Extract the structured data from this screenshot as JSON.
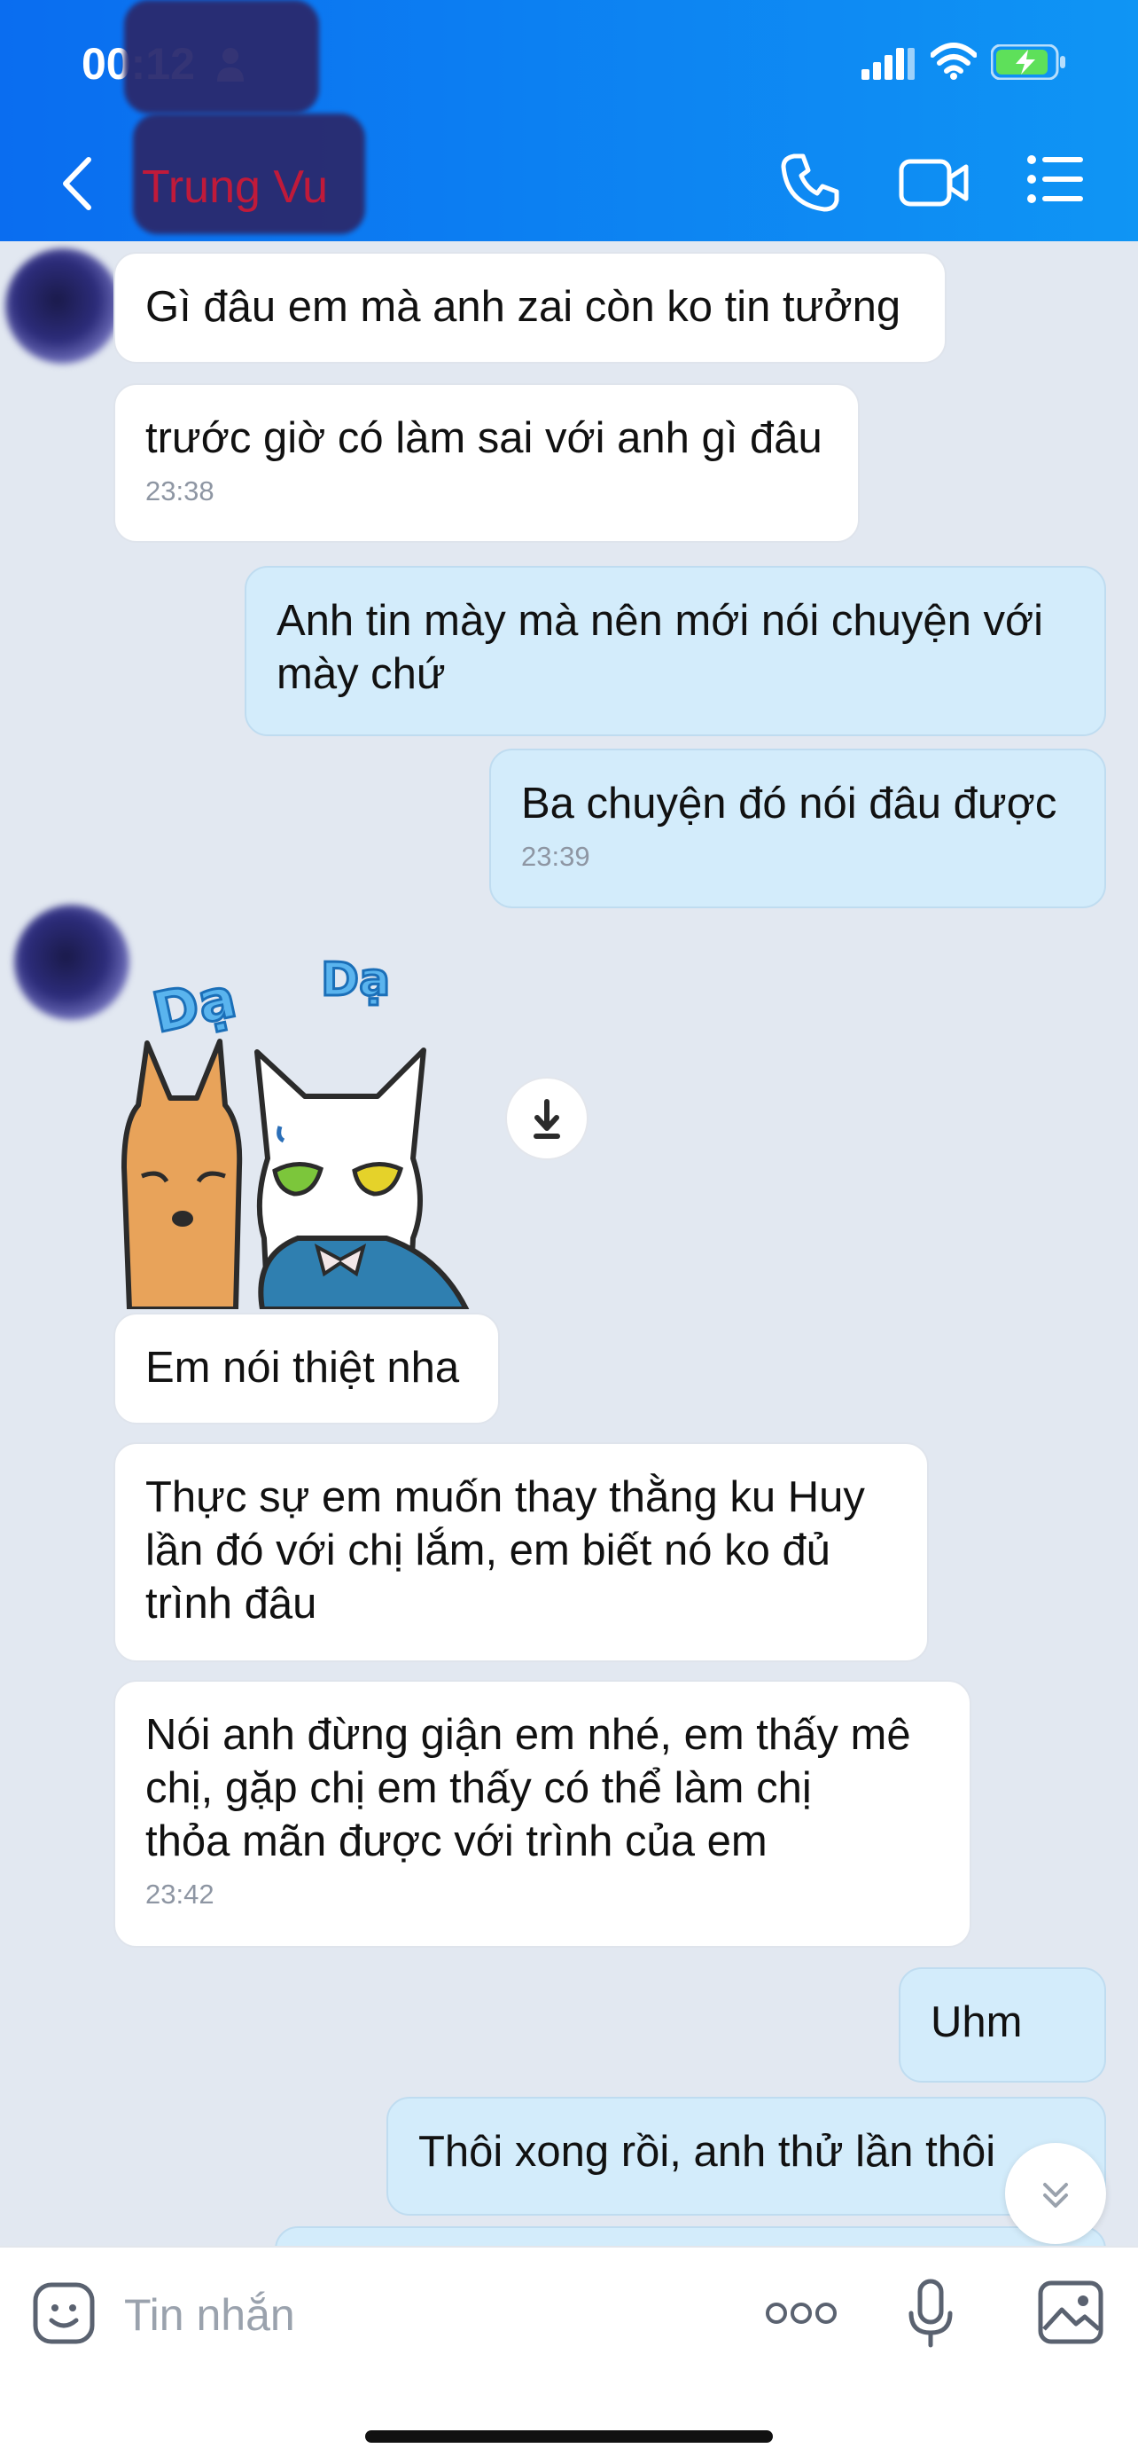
{
  "status_bar": {
    "time": "00:12"
  },
  "header": {
    "contact_name": "Trung Vu"
  },
  "messages": [
    {
      "text": "Gì đâu em mà anh zai còn ko tin tưởng"
    },
    {
      "text": "trước giờ có làm sai với anh gì đâu",
      "time": "23:38"
    },
    {
      "text": "Anh tin mày mà nên mới nói chuyện với\nmày chứ"
    },
    {
      "text": "Ba chuyện đó nói đâu được",
      "time": "23:39"
    },
    {
      "text": "Em nói thiệt nha"
    },
    {
      "text": "Thực sự em muốn thay thằng ku Huy\nlần đó với chị lắm, em biết nó ko đủ\ntrình đâu"
    },
    {
      "text": "Nói anh đừng giận em nhé, em thấy mê\nchị, gặp chị em thấy có thể làm chị\nthỏa mãn được với trình của em",
      "time": "23:42"
    },
    {
      "text": "Uhm"
    },
    {
      "text": "Thôi xong rồi, anh thử lần thôi"
    }
  ],
  "sticker": {
    "label_left": "Dạ",
    "label_right": "Dạ"
  },
  "input": {
    "placeholder": "Tin nhắn"
  },
  "colors": {
    "header_start": "#0a6df0",
    "header_end": "#0f95f4",
    "chat_background": "#e2e8f1",
    "incoming_bubble": "#ffffff",
    "outgoing_bubble": "#d3ecfb",
    "timestamp": "#8e96a3"
  },
  "icons": [
    "person-icon",
    "signal-icon",
    "wifi-icon",
    "battery-charging-icon",
    "back-chevron-icon",
    "phone-icon",
    "video-call-icon",
    "list-menu-icon",
    "download-icon",
    "chevron-double-down-icon",
    "emoji-icon",
    "more-dots-icon",
    "microphone-icon",
    "image-icon"
  ]
}
